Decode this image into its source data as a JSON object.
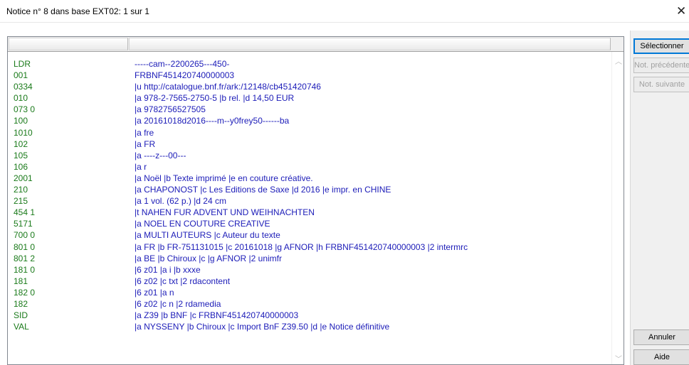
{
  "window": {
    "title": "Notice n° 8 dans base EXT02: 1 sur 1",
    "close_glyph": "✕"
  },
  "record": {
    "rows": [
      {
        "tag": "LDR",
        "value": "-----cam--2200265---450-"
      },
      {
        "tag": "001",
        "value": "FRBNF451420740000003"
      },
      {
        "tag": "0334",
        "value": "|u http://catalogue.bnf.fr/ark:/12148/cb451420746"
      },
      {
        "tag": "010",
        "value": "|a 978-2-7565-2750-5 |b rel. |d 14,50 EUR"
      },
      {
        "tag": "073 0",
        "value": "|a 9782756527505"
      },
      {
        "tag": "100",
        "value": "|a 20161018d2016----m--y0frey50------ba"
      },
      {
        "tag": "1010",
        "value": "|a fre"
      },
      {
        "tag": "102",
        "value": "|a FR"
      },
      {
        "tag": "105",
        "value": "|a ----z---00---"
      },
      {
        "tag": "106",
        "value": "|a r"
      },
      {
        "tag": "2001",
        "value": "|a Noël |b Texte imprimé |e en couture créative."
      },
      {
        "tag": "210",
        "value": "|a CHAPONOST |c Les Editions de Saxe |d 2016 |e impr. en CHINE"
      },
      {
        "tag": "215",
        "value": "|a 1 vol. (62 p.) |d 24 cm"
      },
      {
        "tag": "454 1",
        "value": "|t NAHEN FUR ADVENT UND WEIHNACHTEN"
      },
      {
        "tag": "5171",
        "value": "|a NOEL EN COUTURE CREATIVE"
      },
      {
        "tag": "700 0",
        "value": "|a MULTI AUTEURS |c Auteur du texte"
      },
      {
        "tag": "801 0",
        "value": "|a FR |b FR-751131015 |c 20161018 |g AFNOR |h FRBNF451420740000003 |2 intermrc"
      },
      {
        "tag": "801 2",
        "value": "|a BE |b Chiroux |c  |g AFNOR |2 unimfr"
      },
      {
        "tag": "181 0",
        "value": "|6 z01 |a i  |b xxxe"
      },
      {
        "tag": "181",
        "value": "|6 z02 |c txt |2 rdacontent"
      },
      {
        "tag": "182 0",
        "value": "|6 z01 |a n"
      },
      {
        "tag": "182",
        "value": "|6 z02 |c n |2 rdamedia"
      },
      {
        "tag": "SID",
        "value": "|a Z39 |b BNF |c FRBNF451420740000003"
      },
      {
        "tag": "VAL",
        "value": "|a NYSSENY |b Chiroux |c Import BnF Z39.50 |d  |e Notice définitive"
      }
    ]
  },
  "scrollbar": {
    "up_glyph": "︿",
    "down_glyph": "﹀"
  },
  "buttons": {
    "select": "Sélectionner",
    "previous": "Not. précédente",
    "next": "Not. suivante",
    "cancel": "Annuler",
    "help": "Aide"
  },
  "colors": {
    "tag_color": "#1a7a1a",
    "value_color": "#1c1cb8",
    "panel_bg": "#f0f0f0"
  }
}
